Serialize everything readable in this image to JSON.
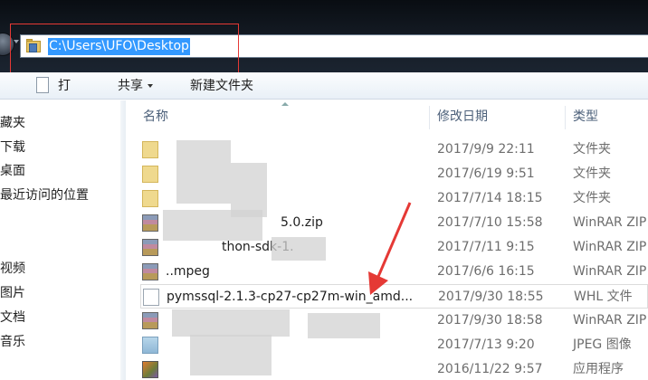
{
  "address": {
    "path": "C:\\Users\\UFO\\Desktop"
  },
  "toolbar": {
    "open_label": "打开",
    "share_label": "共享",
    "new_folder_label": "新建文件夹"
  },
  "sidebar": {
    "items": [
      {
        "label": "藏夹"
      },
      {
        "label": "下载"
      },
      {
        "label": "桌面"
      },
      {
        "label": "最近访问的位置"
      },
      {
        "label": "视频"
      },
      {
        "label": "图片"
      },
      {
        "label": "文档"
      },
      {
        "label": "音乐"
      }
    ]
  },
  "columns": {
    "name": "名称",
    "modified": "修改日期",
    "type": "类型"
  },
  "files": [
    {
      "name": "",
      "date": "2017/9/9 22:11",
      "type": "文件夹",
      "icon": "folder-icon"
    },
    {
      "name": "",
      "date": "2017/6/19 9:51",
      "type": "文件夹",
      "icon": "folder-icon"
    },
    {
      "name": "",
      "date": "2017/7/14 18:15",
      "type": "文件夹",
      "icon": "folder-icon"
    },
    {
      "name": "5.0.zip",
      "date": "2017/7/10 15:58",
      "type": "WinRAR ZIP",
      "icon": "zip-icon"
    },
    {
      "name": "thon-sdk-1.",
      "date": "2017/7/11 9:15",
      "type": "WinRAR ZIP",
      "icon": "zip-icon"
    },
    {
      "name": "..mpeg",
      "date": "2017/6/6 16:15",
      "type": "WinRAR ZIP",
      "icon": "zip-icon"
    },
    {
      "name": "pymssql-2.1.3-cp27-cp27m-win_amd...",
      "date": "2017/9/30 18:55",
      "type": "WHL 文件",
      "icon": "whl-file-icon"
    },
    {
      "name": "",
      "date": "2017/9/30 18:58",
      "type": "WinRAR ZIP",
      "icon": "zip-icon"
    },
    {
      "name": "",
      "date": "2017/7/13 9:20",
      "type": "JPEG 图像",
      "icon": "jpeg-icon"
    },
    {
      "name": "",
      "date": "2016/11/22 9:57",
      "type": "应用程序",
      "icon": "exe-icon"
    }
  ],
  "colors": {
    "selection": "#3399ff",
    "annotation": "#e53935"
  }
}
